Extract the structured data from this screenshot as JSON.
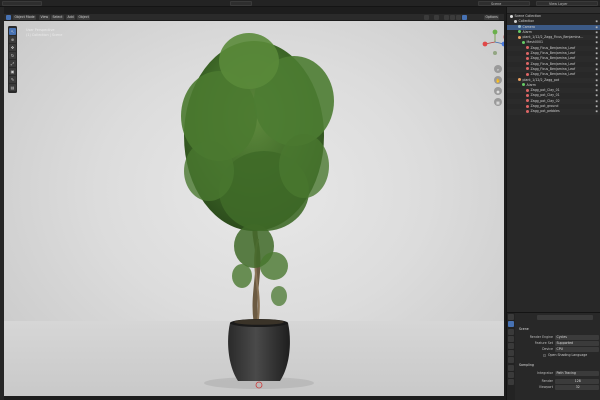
{
  "topbar": {
    "scene": "Scene",
    "view_layer": "View Layer",
    "options": "Options"
  },
  "viewport": {
    "mode": "Object Mode",
    "menus": [
      "View",
      "Select",
      "Add",
      "Object"
    ],
    "overlay_lines": [
      "User Perspective",
      "(1) Collection | Scene"
    ]
  },
  "outliner": {
    "title": "Scene Collection",
    "rows": [
      {
        "label": "Collection",
        "level": 1,
        "color": "#cfcfcf",
        "sel": false
      },
      {
        "label": "Camera",
        "level": 2,
        "color": "#9bc",
        "sel": true
      },
      {
        "label": "Alarm",
        "level": 2,
        "color": "#6c6",
        "sel": false
      },
      {
        "label": "plant_1/12/2_Zagg_Ficus_Benjamina...",
        "level": 2,
        "color": "#e8a060",
        "sel": false
      },
      {
        "label": "Mesh0001",
        "level": 3,
        "color": "#6c6",
        "sel": false
      },
      {
        "label": "Zagg_Ficus_Benjamina_Leaf",
        "level": 4,
        "color": "#d66",
        "sel": false
      },
      {
        "label": "Zagg_Ficus_Benjamina_Leaf",
        "level": 4,
        "color": "#d66",
        "sel": false
      },
      {
        "label": "Zagg_Ficus_Benjamina_Leaf",
        "level": 4,
        "color": "#d66",
        "sel": false
      },
      {
        "label": "Zagg_Ficus_Benjamina_Leaf",
        "level": 4,
        "color": "#d66",
        "sel": false
      },
      {
        "label": "Zagg_Ficus_Benjamina_Leaf",
        "level": 4,
        "color": "#d66",
        "sel": false
      },
      {
        "label": "Zagg_Ficus_Benjamina_Leaf",
        "level": 4,
        "color": "#d66",
        "sel": false
      },
      {
        "label": "plant_1/12/2_Zagg_pot",
        "level": 2,
        "color": "#e8a060",
        "sel": false
      },
      {
        "label": "Alarm",
        "level": 3,
        "color": "#6c6",
        "sel": false
      },
      {
        "label": "Zagg_pot_Clay_01",
        "level": 4,
        "color": "#d66",
        "sel": false
      },
      {
        "label": "Zagg_pot_Clay_01",
        "level": 4,
        "color": "#d66",
        "sel": false
      },
      {
        "label": "Zagg_pot_Clay_02",
        "level": 4,
        "color": "#d66",
        "sel": false
      },
      {
        "label": "Zagg_pot_ground",
        "level": 4,
        "color": "#d66",
        "sel": false
      },
      {
        "label": "Zagg_pot_pebbles",
        "level": 4,
        "color": "#d66",
        "sel": false
      }
    ]
  },
  "properties": {
    "section": "Scene",
    "render_engine": {
      "label": "Render Engine",
      "value": "Cycles"
    },
    "feature_set": {
      "label": "Feature Set",
      "value": "Supported"
    },
    "device": {
      "label": "Device",
      "value": "CPU"
    },
    "osl": "Open Shading Language",
    "sampling": "Sampling",
    "integrator": {
      "label": "Integrator",
      "value": "Path Tracing"
    },
    "render": {
      "label": "Render",
      "value": "128"
    },
    "viewport": {
      "label": "Viewport",
      "value": "32"
    }
  }
}
